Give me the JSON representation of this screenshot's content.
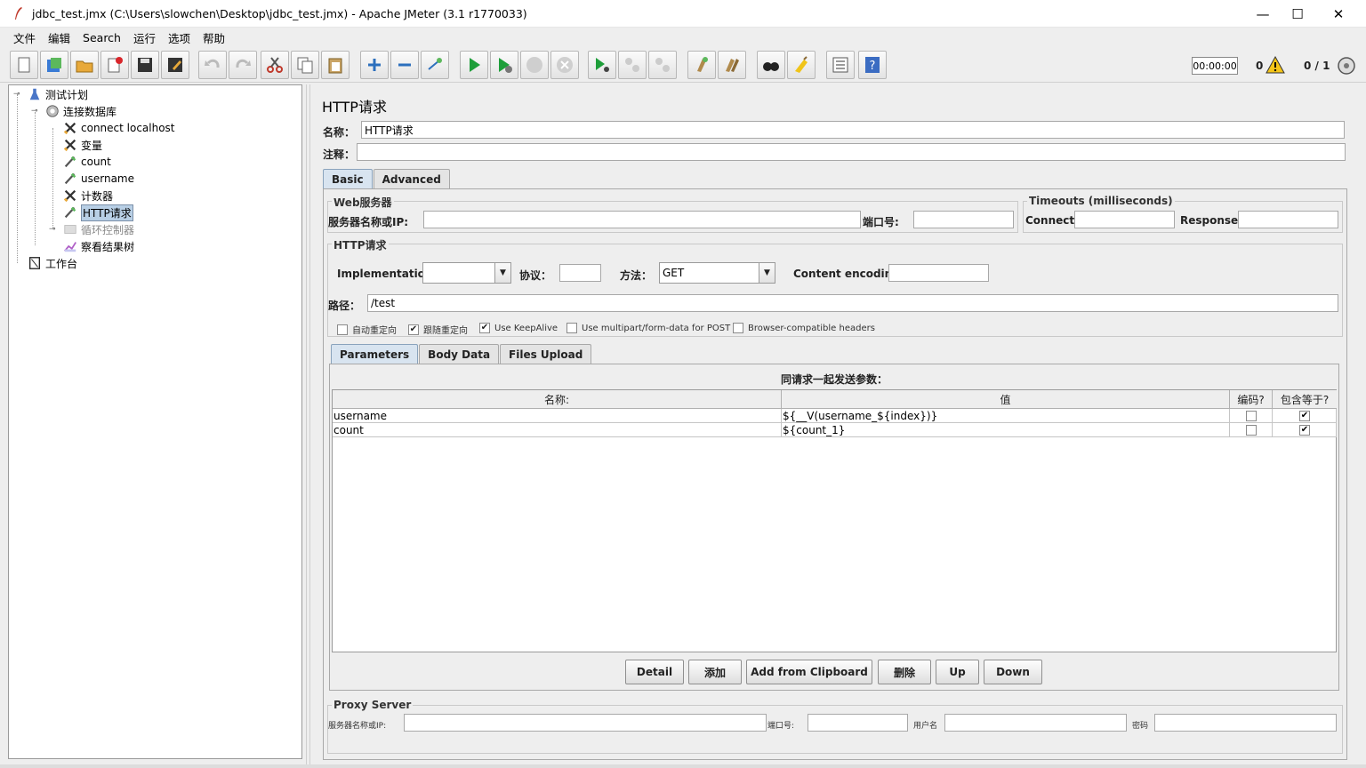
{
  "window": {
    "title": "jdbc_test.jmx (C:\\Users\\slowchen\\Desktop\\jdbc_test.jmx) - Apache JMeter (3.1 r1770033)",
    "minimize": "—",
    "maximize": "☐",
    "close": "✕"
  },
  "menu": [
    "文件",
    "编辑",
    "Search",
    "运行",
    "选项",
    "帮助"
  ],
  "toolbar": {
    "icons": [
      "new-icon",
      "templates-icon",
      "open-icon",
      "close-icon",
      "save-icon",
      "save-as-icon",
      "undo-icon",
      "redo-icon",
      "cut-icon",
      "copy-icon",
      "paste-icon",
      "expand-icon",
      "collapse-icon",
      "toggle-icon",
      "start-icon",
      "start-no-pause-icon",
      "stop-icon",
      "shutdown-icon",
      "remote-start-icon",
      "remote-stop-icon",
      "remote-shutdown-icon",
      "clear-icon",
      "clear-all-icon",
      "search-icon",
      "reset-search-icon",
      "function-helper-icon",
      "help-icon"
    ],
    "timer": "00:00:00",
    "warnings": "0",
    "threads": "0 / 1"
  },
  "tree": {
    "nodes": [
      {
        "label": "测试计划",
        "icon": "test-plan-icon"
      },
      {
        "label": "连接数据库",
        "icon": "thread-group-icon"
      },
      {
        "label": "connect localhost",
        "icon": "config-element-icon"
      },
      {
        "label": "变量",
        "icon": "config-element-icon"
      },
      {
        "label": "count",
        "icon": "sampler-icon"
      },
      {
        "label": "username",
        "icon": "sampler-icon"
      },
      {
        "label": "计数器",
        "icon": "config-element-icon"
      },
      {
        "label": "HTTP请求",
        "icon": "sampler-icon"
      },
      {
        "label": "循环控制器",
        "icon": "controller-icon"
      },
      {
        "label": "察看结果树",
        "icon": "listener-icon"
      },
      {
        "label": "工作台",
        "icon": "workbench-icon"
      }
    ]
  },
  "form": {
    "heading": "HTTP请求",
    "name_label": "名称：",
    "name_value": "HTTP请求",
    "comment_label": "注释：",
    "comment_value": "",
    "tabs": [
      "Basic",
      "Advanced"
    ],
    "web_server": {
      "title": "Web服务器",
      "server_label": "服务器名称或IP:",
      "server_value": "",
      "port_label": "端口号:",
      "port_value": ""
    },
    "timeouts": {
      "title": "Timeouts (milliseconds)",
      "connect_label": "Connect:",
      "connect_value": "",
      "response_label": "Response:",
      "response_value": ""
    },
    "http_request": {
      "title": "HTTP请求",
      "impl_label": "Implementation:",
      "impl_value": "",
      "protocol_label": "协议：",
      "protocol_value": "",
      "method_label": "方法：",
      "method_value": "GET",
      "encoding_label": "Content encoding:",
      "encoding_value": "",
      "path_label": "路径：",
      "path_value": "/test"
    },
    "options": [
      {
        "label": "自动重定向",
        "checked": false
      },
      {
        "label": "跟随重定向",
        "checked": true
      },
      {
        "label": "Use KeepAlive",
        "checked": true
      },
      {
        "label": "Use multipart/form-data for POST",
        "checked": false
      },
      {
        "label": "Browser-compatible headers",
        "checked": false
      }
    ],
    "subtabs": [
      "Parameters",
      "Body Data",
      "Files Upload"
    ],
    "params": {
      "caption": "同请求一起发送参数：",
      "columns": [
        "名称:",
        "值",
        "编码?",
        "包含等于?"
      ],
      "rows": [
        {
          "name": "username",
          "value": "${__V(username_${index})}",
          "encode": false,
          "include_equals": true
        },
        {
          "name": "count",
          "value": "${count_1}",
          "encode": false,
          "include_equals": true
        }
      ]
    },
    "buttons": [
      "Detail",
      "添加",
      "Add from Clipboard",
      "删除",
      "Up",
      "Down"
    ],
    "proxy": {
      "title": "Proxy Server",
      "server_label": "服务器名称或IP:",
      "port_label": "端口号:",
      "user_label": "用户名",
      "password_label": "密码"
    }
  }
}
